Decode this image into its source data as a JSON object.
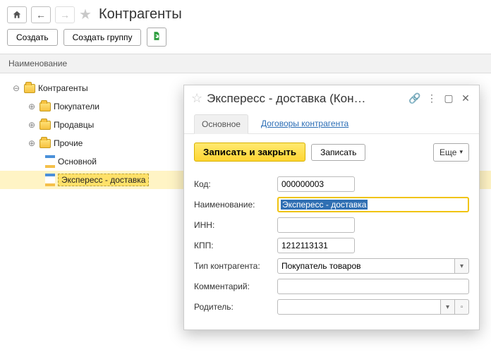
{
  "header": {
    "title": "Контрагенты"
  },
  "toolbar": {
    "create": "Создать",
    "create_group": "Создать группу"
  },
  "list": {
    "column_name": "Наименование"
  },
  "tree": {
    "root": "Контрагенты",
    "items": [
      {
        "label": "Покупатели",
        "kind": "folder"
      },
      {
        "label": "Продавцы",
        "kind": "folder"
      },
      {
        "label": "Прочие",
        "kind": "folder"
      },
      {
        "label": "Основной",
        "kind": "item"
      },
      {
        "label": "Экспересс - доставка",
        "kind": "item",
        "selected": true
      }
    ]
  },
  "dialog": {
    "title": "Экспересс - доставка (Кон…",
    "tabs": {
      "main": "Основное",
      "contracts": "Договоры контрагента"
    },
    "actions": {
      "save_close": "Записать и закрыть",
      "save": "Записать",
      "more": "Еще"
    },
    "fields": {
      "code": {
        "label": "Код:",
        "value": "000000003"
      },
      "name": {
        "label": "Наименование:",
        "value": "Экспересс - доставка"
      },
      "inn": {
        "label": "ИНН:",
        "value": ""
      },
      "kpp": {
        "label": "КПП:",
        "value": "1212113131"
      },
      "type": {
        "label": "Тип контрагента:",
        "value": "Покупатель товаров"
      },
      "comment": {
        "label": "Комментарий:",
        "value": ""
      },
      "parent": {
        "label": "Родитель:",
        "value": ""
      }
    }
  }
}
